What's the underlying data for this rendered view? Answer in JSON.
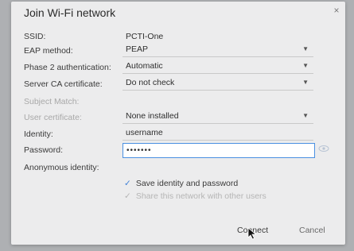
{
  "dialog": {
    "title": "Join Wi-Fi network",
    "close_glyph": "×"
  },
  "rows": {
    "ssid": {
      "label": "SSID:",
      "value": "PCTI-One"
    },
    "eap_method": {
      "label": "EAP method:",
      "value": "PEAP"
    },
    "phase2": {
      "label": "Phase 2 authentication:",
      "value": "Automatic"
    },
    "server_ca": {
      "label": "Server CA certificate:",
      "value": "Do not check"
    },
    "subject_match": {
      "label": "Subject Match:",
      "value": ""
    },
    "user_cert": {
      "label": "User certificate:",
      "value": "None installed"
    },
    "identity": {
      "label": "Identity:",
      "value": "username"
    },
    "password": {
      "label": "Password:",
      "value": "•••••••"
    },
    "anonymous": {
      "label": "Anonymous identity:",
      "value": ""
    }
  },
  "checks": {
    "save": {
      "label": "Save identity and password",
      "checked": true
    },
    "share": {
      "label": "Share this network with other users",
      "checked": true,
      "disabled": true
    }
  },
  "buttons": {
    "connect": "Connect",
    "cancel": "Cancel"
  },
  "icons": {
    "close": "close-icon",
    "dropdown": "chevron-down-icon",
    "show_password": "eye-icon",
    "check": "checkmark-icon",
    "cursor": "mouse-pointer-icon"
  },
  "colors": {
    "accent": "#4a90e2",
    "dialog_bg": "#ececed"
  }
}
